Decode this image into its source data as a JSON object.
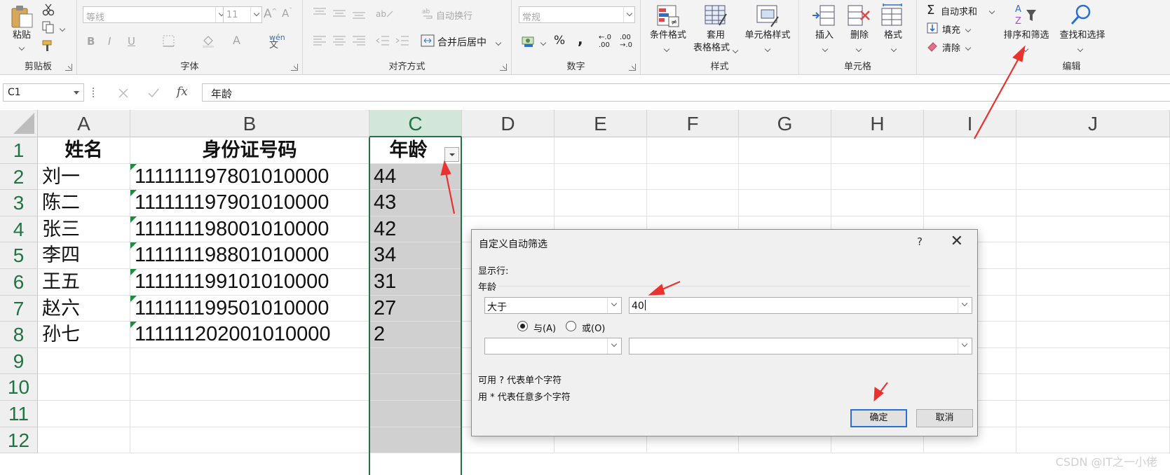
{
  "ribbon": {
    "clipboard": {
      "paste_label": "粘贴",
      "group_label": "剪贴板"
    },
    "font": {
      "font_name": "等线",
      "font_size": "11",
      "group_label": "字体",
      "bold": "B",
      "italic": "I",
      "underline": "U"
    },
    "alignment": {
      "wrap_label": "自动换行",
      "merge_label": "合并后居中",
      "group_label": "对齐方式"
    },
    "number": {
      "format": "常规",
      "percent": "%",
      "comma": ",",
      "inc_decimal": ".00",
      "dec_decimal": ".0",
      "group_label": "数字"
    },
    "styles": {
      "cond_format": "条件格式",
      "table_format_1": "套用",
      "table_format_2": "表格格式",
      "cell_styles": "单元格样式",
      "group_label": "样式"
    },
    "cells": {
      "insert": "插入",
      "delete": "删除",
      "format": "格式",
      "group_label": "单元格"
    },
    "editing": {
      "autosum": "自动求和",
      "fill": "填充",
      "clear": "清除",
      "sort_filter": "排序和筛选",
      "find_select": "查找和选择",
      "group_label": "编辑"
    }
  },
  "formula_bar": {
    "name_box": "C1",
    "fx": "fx",
    "content": "年龄"
  },
  "sheet": {
    "columns": [
      "A",
      "B",
      "C",
      "D",
      "E",
      "F",
      "G",
      "H",
      "I",
      "J"
    ],
    "rows": [
      "1",
      "2",
      "3",
      "4",
      "5",
      "6",
      "7",
      "8",
      "9",
      "10",
      "11",
      "12"
    ],
    "headers": {
      "name": "姓名",
      "id": "身份证号码",
      "age": "年龄"
    },
    "data": [
      {
        "name": "刘一",
        "id": "111111197801010000",
        "age": "44"
      },
      {
        "name": "陈二",
        "id": "111111197901010000",
        "age": "43"
      },
      {
        "name": "张三",
        "id": "111111198001010000",
        "age": "42"
      },
      {
        "name": "李四",
        "id": "111111198801010000",
        "age": "34"
      },
      {
        "name": "王五",
        "id": "111111199101010000",
        "age": "31"
      },
      {
        "name": "赵六",
        "id": "111111199501010000",
        "age": "27"
      },
      {
        "name": "孙七",
        "id": "111111202001010000",
        "age": "2"
      }
    ]
  },
  "dialog": {
    "title": "自定义自动筛选",
    "help": "?",
    "show_rows": "显示行:",
    "field": "年龄",
    "operator1": "大于",
    "value1": "40",
    "and_label": "与(A)",
    "or_label": "或(O)",
    "operator2": "",
    "value2": "",
    "hint1": "可用 ? 代表单个字符",
    "hint2": "用 * 代表任意多个字符",
    "ok": "确定",
    "cancel": "取消"
  },
  "watermark": "CSDN @IT之一小佬",
  "colors": {
    "accent_green": "#217346",
    "arrow_red": "#e8332f",
    "selected_fill": "#d0d0d0",
    "default_button_border": "#2d6fd1"
  }
}
